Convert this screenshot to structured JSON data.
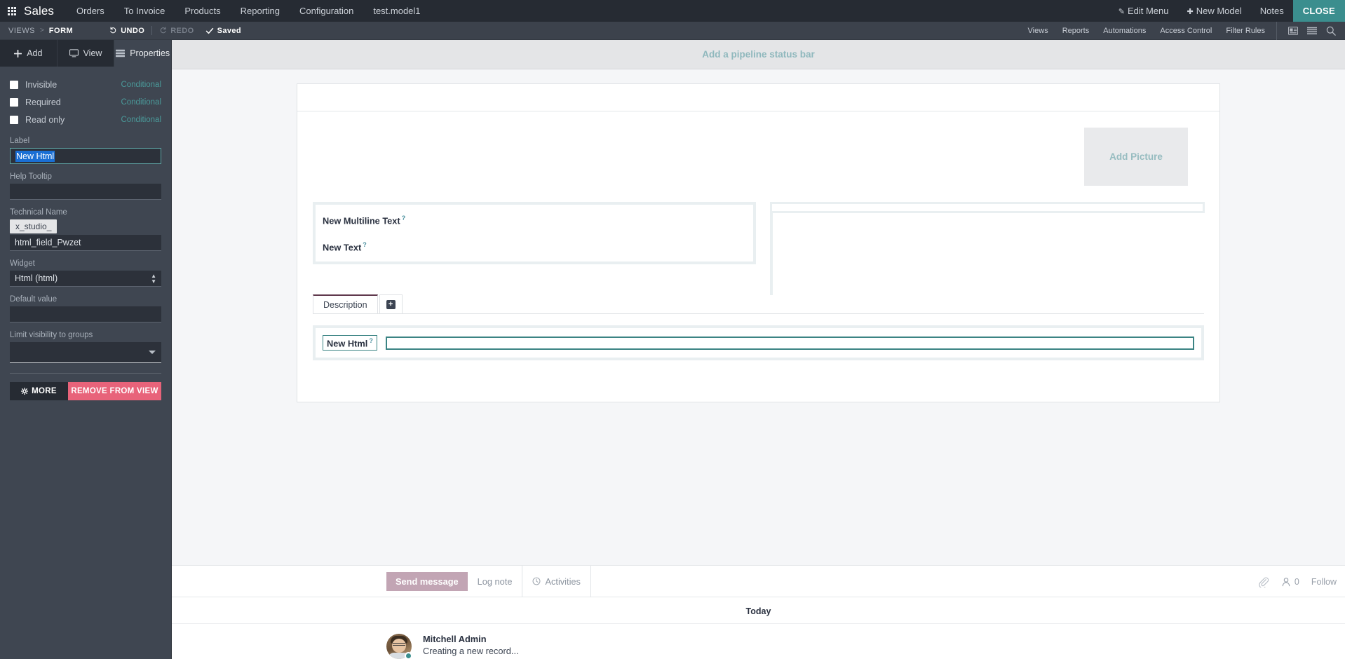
{
  "navbar": {
    "apps_icon": "apps-grid-icon",
    "brand": "Sales",
    "menu": [
      {
        "label": "Orders"
      },
      {
        "label": "To Invoice"
      },
      {
        "label": "Products"
      },
      {
        "label": "Reporting"
      },
      {
        "label": "Configuration"
      },
      {
        "label": "test.model1"
      }
    ],
    "right": [
      {
        "label": "Edit Menu",
        "icon": "pencil-icon"
      },
      {
        "label": "New Model",
        "icon": "plus-icon"
      },
      {
        "label": "Notes",
        "icon": ""
      }
    ],
    "close_label": "CLOSE",
    "close_color": "#3b8e8e",
    "bg_color": "#262b33"
  },
  "subheader": {
    "breadcrumb": {
      "root": "VIEWS",
      "separator": ">",
      "current": "FORM"
    },
    "undo_label": "UNDO",
    "redo_label": "REDO",
    "saved_label": "Saved",
    "links": [
      {
        "label": "Views"
      },
      {
        "label": "Reports"
      },
      {
        "label": "Automations"
      },
      {
        "label": "Access Control"
      },
      {
        "label": "Filter Rules"
      }
    ],
    "icons": [
      "kanban-view-icon",
      "list-view-icon",
      "search-icon"
    ],
    "bg_color": "#3c424c"
  },
  "sidebar": {
    "tabs": [
      {
        "label": "Add",
        "icon": "plus-icon",
        "active": false
      },
      {
        "label": "View",
        "icon": "monitor-icon",
        "active": false
      },
      {
        "label": "Properties",
        "icon": "properties-icon",
        "active": true
      }
    ],
    "checkboxes": [
      {
        "label": "Invisible",
        "checked": false,
        "conditional": "Conditional"
      },
      {
        "label": "Required",
        "checked": false,
        "conditional": "Conditional"
      },
      {
        "label": "Read only",
        "checked": false,
        "conditional": "Conditional"
      }
    ],
    "label_field": {
      "label": "Label",
      "value": "New Html",
      "selected": true
    },
    "help_tooltip": {
      "label": "Help Tooltip",
      "value": ""
    },
    "technical_name": {
      "label": "Technical Name",
      "prefix": "x_studio_",
      "value": "html_field_Pwzet"
    },
    "widget": {
      "label": "Widget",
      "value": "Html (html)"
    },
    "default_value": {
      "label": "Default value",
      "value": ""
    },
    "limit_visibility": {
      "label": "Limit visibility to groups",
      "value": ""
    },
    "more_button": "MORE",
    "remove_button": "REMOVE FROM VIEW",
    "accent_color": "#4a9a9a",
    "remove_color": "#e8637a"
  },
  "canvas": {
    "pipeline_placeholder": "Add a pipeline status bar",
    "add_picture": "Add Picture",
    "fields": [
      {
        "label": "New Multiline Text",
        "help": "?"
      },
      {
        "label": "New Text",
        "help": "?"
      }
    ],
    "notebook": {
      "tabs": [
        {
          "label": "Description",
          "active": true
        }
      ],
      "add_tab_icon": "plus-square-icon",
      "page_field": {
        "label": "New Html",
        "help": "?",
        "value": ""
      }
    }
  },
  "chatter": {
    "send_message": "Send message",
    "log_note": "Log note",
    "activities": "Activities",
    "activities_icon": "clock-icon",
    "attachment_icon": "paperclip-icon",
    "followers_icon": "person-icon",
    "followers_count": "0",
    "follow_label": "Follow",
    "today_label": "Today",
    "messages": [
      {
        "author": "Mitchell Admin",
        "body": "Creating a new record...",
        "avatar": "user-avatar"
      }
    ]
  }
}
